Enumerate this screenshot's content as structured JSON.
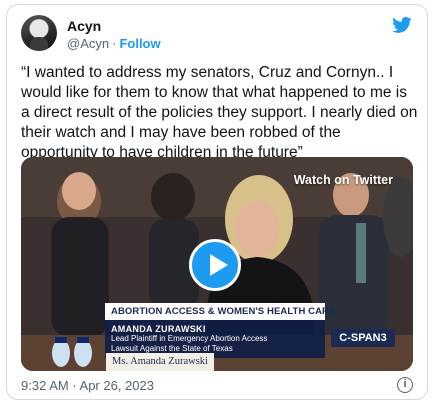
{
  "author": {
    "display_name": "Acyn",
    "handle": "@Acyn",
    "separator": "·",
    "follow_label": "Follow"
  },
  "tweet": {
    "text": "“I wanted to address my senators, Cruz and Cornyn.. I would like for them to know that what happened to me is a direct result of the policies they support. I nearly died on their watch and I may have been robbed of the opportunity to have children in the future”"
  },
  "media": {
    "watch_label": "Watch on Twitter",
    "banner": "ABORTION ACCESS & WOMEN'S HEALTH CARE",
    "speaker_name": "AMANDA ZURAWSKI",
    "speaker_role_1": "Lead Plaintiff in Emergency Abortion Access",
    "speaker_role_2": "Lawsuit Against the State of Texas",
    "network_logo": "C-SPAN3",
    "nameplate": "Ms. Amanda Zurawski"
  },
  "footer": {
    "timestamp": "9:32 AM · Apr 26, 2023",
    "info_icon_glyph": "i"
  },
  "colors": {
    "accent": "#1d9bf0",
    "text_primary": "#0f1419",
    "text_secondary": "#536471"
  },
  "icons": [
    "twitter-bird-icon",
    "play-icon",
    "info-icon"
  ]
}
